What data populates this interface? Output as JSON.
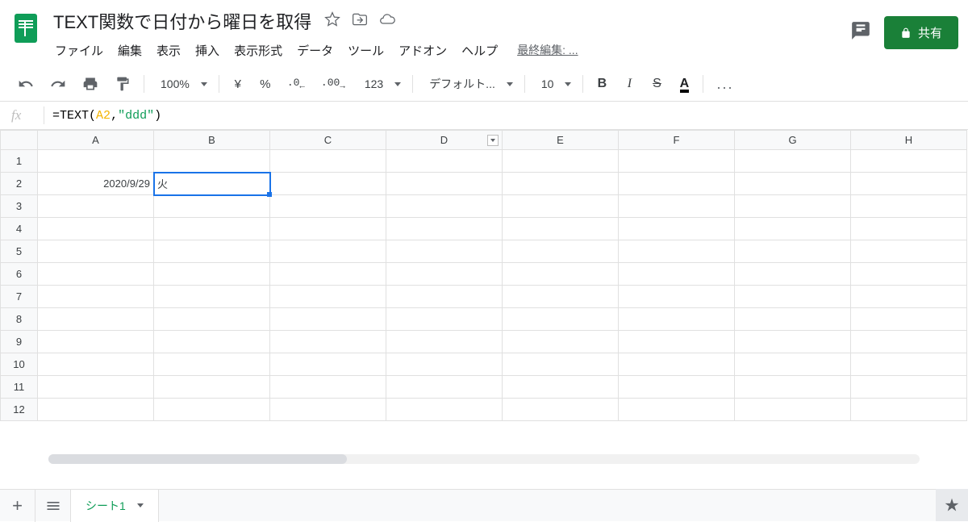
{
  "doc": {
    "title": "TEXT関数で日付から曜日を取得"
  },
  "menus": [
    "ファイル",
    "編集",
    "表示",
    "挿入",
    "表示形式",
    "データ",
    "ツール",
    "アドオン",
    "ヘルプ"
  ],
  "last_edit": "最終編集: ...",
  "share_label": "共有",
  "toolbar": {
    "zoom": "100%",
    "currency": "¥",
    "percent": "%",
    "dec_less": ".0",
    "dec_more": ".00",
    "format_123": "123",
    "font": "デフォルト...",
    "font_size": "10",
    "more": "..."
  },
  "formula": {
    "prefix": "=",
    "func": "TEXT",
    "open": "(",
    "arg_ref": "A2",
    "comma": ",",
    "arg_str": "\"ddd\"",
    "close": ")"
  },
  "columns": [
    "A",
    "B",
    "C",
    "D",
    "E",
    "F",
    "G",
    "H"
  ],
  "filter_col_index": 3,
  "rows": [
    1,
    2,
    3,
    4,
    5,
    6,
    7,
    8,
    9,
    10,
    11,
    12
  ],
  "cells": {
    "A2": "2020/9/29",
    "B2": "火"
  },
  "selected_cell": "B2",
  "sheet_tab": "シート1"
}
